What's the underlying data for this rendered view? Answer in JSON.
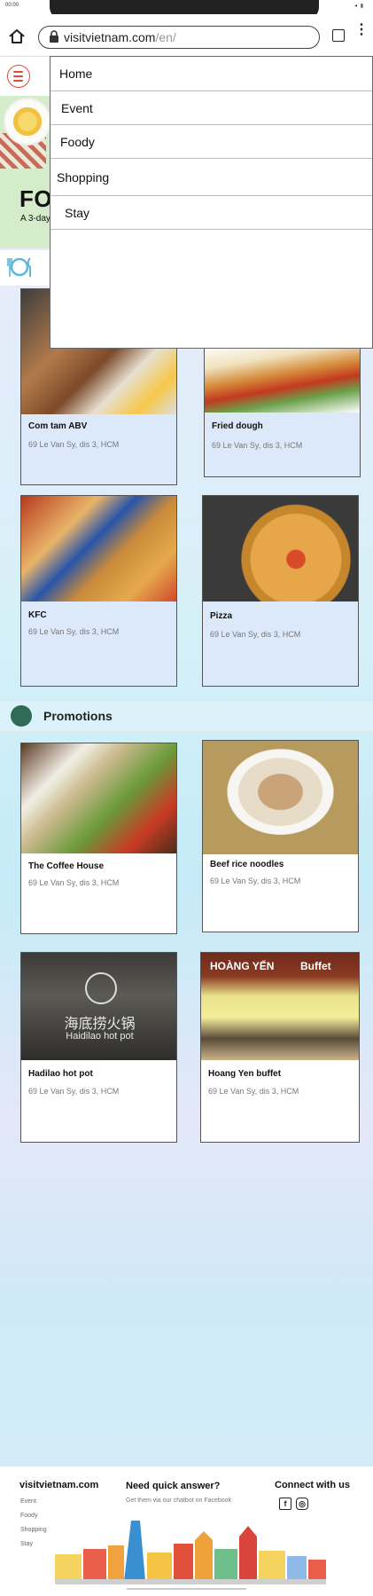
{
  "status_bar": {
    "time": "00:00",
    "icons": "◂ ▮"
  },
  "browser": {
    "url_host": "visitvietnam.com",
    "url_path": "/en/"
  },
  "nav_menu": {
    "items": [
      {
        "label": "Home"
      },
      {
        "label": "Event"
      },
      {
        "label": "Foody"
      },
      {
        "label": "Shopping"
      },
      {
        "label": "Stay"
      }
    ]
  },
  "hero": {
    "title": "FOO",
    "subtitle": "A 3-day"
  },
  "food_cards": [
    {
      "name": "Com tam ABV",
      "address": "69 Le Van Sy, dis 3, HCM"
    },
    {
      "name": "Fried dough",
      "address": "69 Le Van Sy, dis 3, HCM"
    },
    {
      "name": "KFC",
      "address": "69 Le Van Sy, dis 3, HCM"
    },
    {
      "name": "Pizza",
      "address": "69 Le Van Sy, dis 3, HCM"
    }
  ],
  "promotions": {
    "title": "Promotions",
    "cards": [
      {
        "name": "The Coffee House",
        "address": "69 Le Van Sy, dis 3, HCM"
      },
      {
        "name": "Beef rice noodles",
        "address": "69 Le Van Sy, dis 3, HCM"
      },
      {
        "name": "Hadilao hot pot",
        "address": "69 Le Van Sy, dis 3, HCM"
      },
      {
        "name": "Hoang Yen buffet",
        "address": "69 Le Van Sy, dis 3, HCM"
      }
    ],
    "signage": {
      "hadilao_cn": "海底捞火锅",
      "hadilao_en": "Haidilao hot pot",
      "hoang_yen": "HOÀNG YẾN",
      "buffet": "Buffet"
    }
  },
  "footer": {
    "brand": "visitvietnam.com",
    "links": [
      "Event",
      "Foody",
      "Shopping",
      "Stay"
    ],
    "help_title": "Need quick answer?",
    "help_sub": "Get them via our chatbot on Facebook",
    "connect_title": "Connect with us",
    "social": [
      {
        "icon": "facebook-icon",
        "glyph": "f"
      },
      {
        "icon": "instagram-icon",
        "glyph": "◎"
      }
    ]
  },
  "colors": {
    "accent_red": "#e0493d",
    "card_blue": "#dce9fa",
    "hero_green": "#d4ecc9"
  }
}
